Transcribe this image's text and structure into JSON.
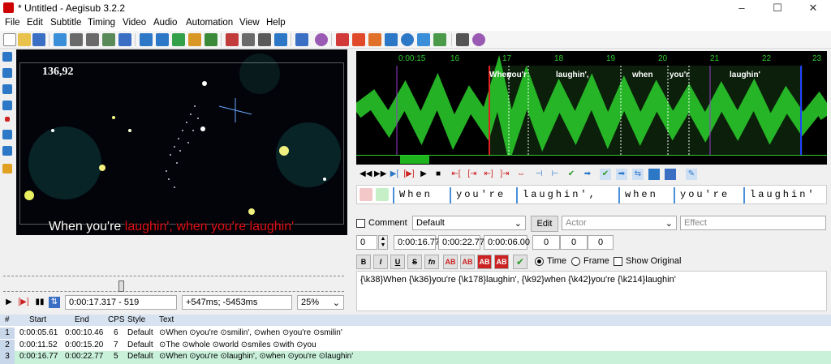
{
  "window": {
    "title": "* Untitled - Aegisub 3.2.2",
    "controls": [
      "–",
      "☐",
      "✕"
    ]
  },
  "menu": [
    "File",
    "Edit",
    "Subtitle",
    "Timing",
    "Video",
    "Audio",
    "Automation",
    "View",
    "Help"
  ],
  "video": {
    "coordinate": "136,92",
    "subtitle_white": "When you're ",
    "subtitle_red": "laughin', when you're laughin'"
  },
  "video_controls": {
    "position": "0:00:17.317 - 519",
    "offset": "+547ms; -5453ms",
    "zoom": "25%"
  },
  "audio": {
    "ticks": [
      "0:00:15",
      "16",
      "17",
      "18",
      "19",
      "20",
      "21",
      "22",
      "23"
    ],
    "syllables": [
      "When",
      "you'r",
      "laughin',",
      "when",
      "you'r",
      "laughin'"
    ]
  },
  "karaoke": [
    "When",
    "you're",
    "laughin',",
    "when",
    "you're",
    "laughin'"
  ],
  "line_editor": {
    "comment_label": "Comment",
    "style": "Default",
    "edit_button": "Edit",
    "actor_placeholder": "Actor",
    "effect_placeholder": "Effect",
    "layer": "0",
    "start": "0:00:16.77",
    "end": "0:00:22.77",
    "duration": "0:00:06.00",
    "margin_l": "0",
    "margin_r": "0",
    "margin_v": "0",
    "fmt_buttons": [
      "B",
      "I",
      "U",
      "S",
      "fn",
      "AB",
      "AB",
      "AB",
      "AB"
    ],
    "time_label": "Time",
    "frame_label": "Frame",
    "show_original_label": "Show Original",
    "text": "{\\k38}When {\\k36}you're {\\k178}laughin', {\\k92}when {\\k42}you're {\\k214}laughin'"
  },
  "grid": {
    "headers": [
      "#",
      "Start",
      "End",
      "CPS",
      "Style",
      "Text"
    ],
    "rows": [
      {
        "n": "1",
        "start": "0:00:05.61",
        "end": "0:00:10.46",
        "cps": "6",
        "style": "Default",
        "text": "⊙When ⊙you're ⊙smilin', ⊙when ⊙you're ⊙smilin'"
      },
      {
        "n": "2",
        "start": "0:00:11.52",
        "end": "0:00:15.20",
        "cps": "7",
        "style": "Default",
        "text": "⊙The ⊙whole ⊙world ⊙smiles ⊙with ⊙you"
      },
      {
        "n": "3",
        "start": "0:00:16.77",
        "end": "0:00:22.77",
        "cps": "5",
        "style": "Default",
        "text": "⊙When ⊙you're ⊙laughin', ⊙when ⊙you're ⊙laughin'"
      }
    ]
  }
}
